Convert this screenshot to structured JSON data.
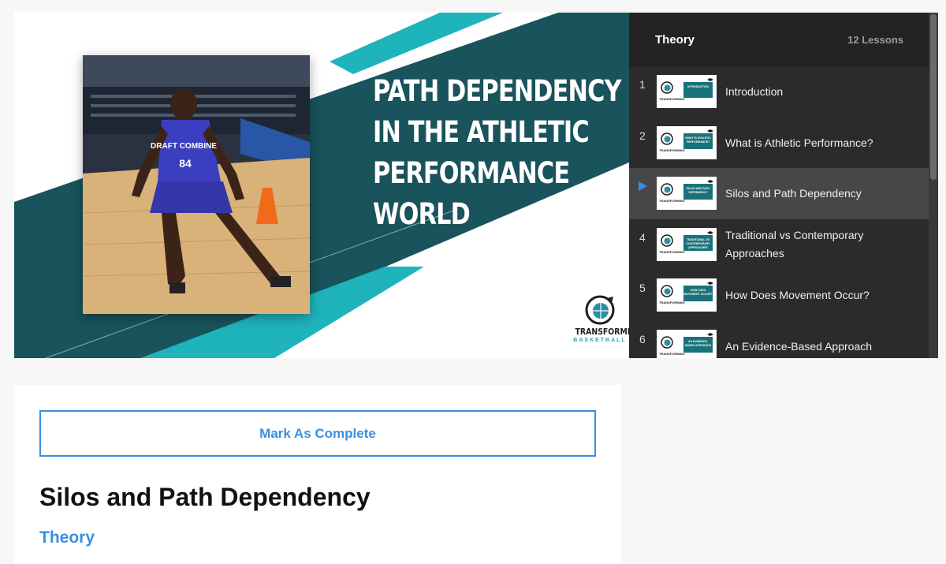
{
  "slide": {
    "title_lines": [
      "PATH DEPENDENCY",
      "IN THE ATHLETIC",
      "PERFORMANCE",
      "WORLD"
    ],
    "brand_main": "TRANSFORMING",
    "brand_sub": "BASKETBALL",
    "jersey_text": "DRAFT COMBINE",
    "jersey_number": "84"
  },
  "playlist": {
    "title": "Theory",
    "count": "12 Lessons",
    "items": [
      {
        "num": "1",
        "label": "Introduction",
        "thumb": "INTRODUCTION",
        "active": false
      },
      {
        "num": "2",
        "label": "What is Athletic Performance?",
        "thumb": "WHAT IS ATHLETIC PERFORMANCE?",
        "active": false
      },
      {
        "num": "3",
        "label": "Silos and Path Dependency",
        "thumb": "SILOS AND PATH DEPENDENCY",
        "active": true
      },
      {
        "num": "4",
        "label": "Traditional vs Contemporary Approaches",
        "thumb": "TRADITIONAL VS CONTEMPORARY APPROACHES",
        "active": false
      },
      {
        "num": "5",
        "label": "How Does Movement Occur?",
        "thumb": "HOW DOES MOVEMENT OCCUR?",
        "active": false
      },
      {
        "num": "6",
        "label": "An Evidence-Based Approach",
        "thumb": "AN EVIDENCE-BASED APPROACH",
        "active": false
      }
    ]
  },
  "lesson": {
    "complete_label": "Mark As Complete",
    "title": "Silos and Path Dependency",
    "category": "Theory"
  },
  "colors": {
    "accent": "#3a8fde",
    "teal_dark": "#19535b",
    "teal_bright": "#1fb3bc",
    "playlist_bg": "#2b2b2b"
  }
}
